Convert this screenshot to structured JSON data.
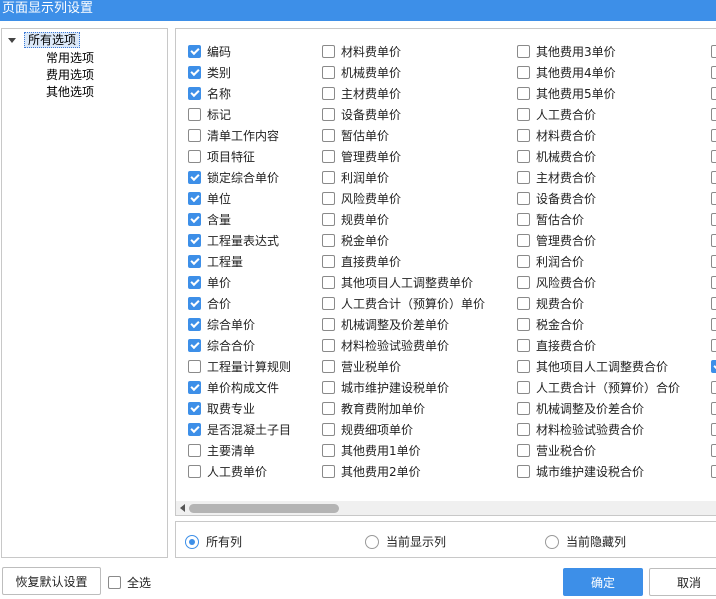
{
  "window": {
    "title": "页面显示列设置"
  },
  "tree": {
    "root": "所有选项",
    "children": [
      "常用选项",
      "费用选项",
      "其他选项"
    ]
  },
  "columns": [
    [
      {
        "label": "编码",
        "checked": true
      },
      {
        "label": "类别",
        "checked": true
      },
      {
        "label": "名称",
        "checked": true
      },
      {
        "label": "标记",
        "checked": false
      },
      {
        "label": "清单工作内容",
        "checked": false
      },
      {
        "label": "项目特征",
        "checked": false
      },
      {
        "label": "锁定综合单价",
        "checked": true
      },
      {
        "label": "单位",
        "checked": true
      },
      {
        "label": "含量",
        "checked": true
      },
      {
        "label": "工程量表达式",
        "checked": true
      },
      {
        "label": "工程量",
        "checked": true
      },
      {
        "label": "单价",
        "checked": true
      },
      {
        "label": "合价",
        "checked": true
      },
      {
        "label": "综合单价",
        "checked": true
      },
      {
        "label": "综合合价",
        "checked": true
      },
      {
        "label": "工程量计算规则",
        "checked": false
      },
      {
        "label": "单价构成文件",
        "checked": true
      },
      {
        "label": "取费专业",
        "checked": true
      },
      {
        "label": "是否混凝土子目",
        "checked": true
      },
      {
        "label": "主要清单",
        "checked": false
      },
      {
        "label": "人工费单价",
        "checked": false
      }
    ],
    [
      {
        "label": "材料费单价",
        "checked": false
      },
      {
        "label": "机械费单价",
        "checked": false
      },
      {
        "label": "主材费单价",
        "checked": false
      },
      {
        "label": "设备费单价",
        "checked": false
      },
      {
        "label": "暂估单价",
        "checked": false
      },
      {
        "label": "管理费单价",
        "checked": false
      },
      {
        "label": "利润单价",
        "checked": false
      },
      {
        "label": "风险费单价",
        "checked": false
      },
      {
        "label": "规费单价",
        "checked": false
      },
      {
        "label": "税金单价",
        "checked": false
      },
      {
        "label": "直接费单价",
        "checked": false
      },
      {
        "label": "其他项目人工调整费单价",
        "checked": false
      },
      {
        "label": "人工费合计（预算价）单价",
        "checked": false
      },
      {
        "label": "机械调整及价差单价",
        "checked": false
      },
      {
        "label": "材料检验试验费单价",
        "checked": false
      },
      {
        "label": "营业税单价",
        "checked": false
      },
      {
        "label": "城市维护建设税单价",
        "checked": false
      },
      {
        "label": "教育费附加单价",
        "checked": false
      },
      {
        "label": "规费细项单价",
        "checked": false
      },
      {
        "label": "其他费用1单价",
        "checked": false
      },
      {
        "label": "其他费用2单价",
        "checked": false
      }
    ],
    [
      {
        "label": "其他费用3单价",
        "checked": false
      },
      {
        "label": "其他费用4单价",
        "checked": false
      },
      {
        "label": "其他费用5单价",
        "checked": false
      },
      {
        "label": "人工费合价",
        "checked": false
      },
      {
        "label": "材料费合价",
        "checked": false
      },
      {
        "label": "机械费合价",
        "checked": false
      },
      {
        "label": "主材费合价",
        "checked": false
      },
      {
        "label": "设备费合价",
        "checked": false
      },
      {
        "label": "暂估合价",
        "checked": false
      },
      {
        "label": "管理费合价",
        "checked": false
      },
      {
        "label": "利润合价",
        "checked": false
      },
      {
        "label": "风险费合价",
        "checked": false
      },
      {
        "label": "规费合价",
        "checked": false
      },
      {
        "label": "税金合价",
        "checked": false
      },
      {
        "label": "直接费合价",
        "checked": false
      },
      {
        "label": "其他项目人工调整费合价",
        "checked": false
      },
      {
        "label": "人工费合计（预算价）合价",
        "checked": false
      },
      {
        "label": "机械调整及价差合价",
        "checked": false
      },
      {
        "label": "材料检验试验费合价",
        "checked": false
      },
      {
        "label": "营业税合价",
        "checked": false
      },
      {
        "label": "城市维护建设税合价",
        "checked": false
      }
    ],
    [
      {
        "label": "",
        "checked": false
      },
      {
        "label": "",
        "checked": false
      },
      {
        "label": "",
        "checked": false
      },
      {
        "label": "",
        "checked": false
      },
      {
        "label": "",
        "checked": false
      },
      {
        "label": "",
        "checked": false
      },
      {
        "label": "",
        "checked": false
      },
      {
        "label": "",
        "checked": false
      },
      {
        "label": "",
        "checked": false
      },
      {
        "label": "",
        "checked": false
      },
      {
        "label": "",
        "checked": false
      },
      {
        "label": "",
        "checked": false
      },
      {
        "label": "",
        "checked": false
      },
      {
        "label": "",
        "checked": false
      },
      {
        "label": "",
        "checked": false
      },
      {
        "label": "",
        "checked": true
      },
      {
        "label": "",
        "checked": false
      },
      {
        "label": "",
        "checked": false
      },
      {
        "label": "",
        "checked": false
      },
      {
        "label": "",
        "checked": false
      },
      {
        "label": "",
        "checked": false
      }
    ]
  ],
  "filter": {
    "options": [
      "所有列",
      "当前显示列",
      "当前隐藏列"
    ],
    "selected_index": 0
  },
  "footer": {
    "restore_label": "恢复默认设置",
    "select_all_label": "全选",
    "select_all_checked": false,
    "ok_label": "确定",
    "cancel_label": "取消"
  },
  "colors": {
    "accent": "#3d8fe8",
    "title_bar": "#3d8fe8"
  }
}
